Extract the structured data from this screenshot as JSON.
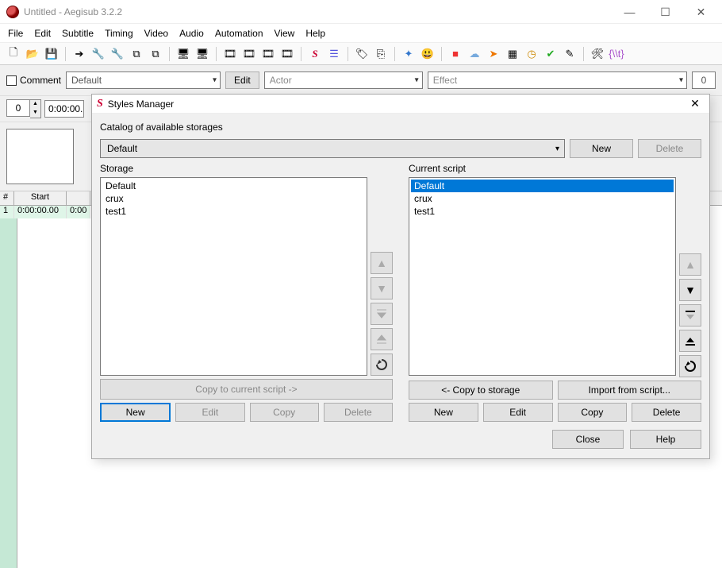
{
  "window": {
    "title": "Untitled - Aegisub 3.2.2"
  },
  "menu": {
    "file": "File",
    "edit": "Edit",
    "subtitle": "Subtitle",
    "timing": "Timing",
    "video": "Video",
    "audio": "Audio",
    "automation": "Automation",
    "view": "View",
    "help": "Help"
  },
  "editbar": {
    "comment_label": "Comment",
    "style": "Default",
    "edit_btn": "Edit",
    "actor_placeholder": "Actor",
    "effect_placeholder": "Effect",
    "layer": "0",
    "spinner": "0",
    "time": "0:00:00."
  },
  "grid": {
    "headers": {
      "num": "#",
      "start": "Start"
    },
    "row": {
      "num": "1",
      "start": "0:00:00.00",
      "end": "0:00"
    }
  },
  "modal": {
    "title": "Styles Manager",
    "catalog_label": "Catalog of available storages",
    "catalog_value": "Default",
    "cat_new": "New",
    "cat_delete": "Delete",
    "storage_label": "Storage",
    "script_label": "Current script",
    "storage_items": [
      "Default",
      "crux",
      "test1"
    ],
    "script_items": [
      "Default",
      "crux",
      "test1"
    ],
    "copy_to_script": "Copy to current script ->",
    "copy_to_storage": "<- Copy to storage",
    "import_script": "Import from script...",
    "new": "New",
    "edit": "Edit",
    "copy": "Copy",
    "delete": "Delete",
    "close": "Close",
    "help": "Help"
  }
}
